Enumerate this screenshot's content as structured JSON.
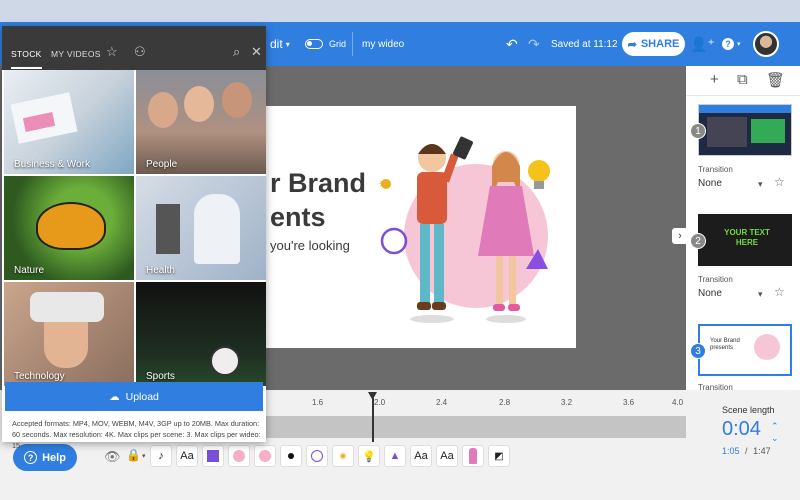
{
  "topbar": {
    "edit_label": "dit",
    "grid_label": "Grid",
    "project_name": "my wideo",
    "saved_label": "Saved at 11:12",
    "share_label": "SHARE"
  },
  "slide": {
    "line1": "r Brand",
    "line2": "ents",
    "line3": "you're looking"
  },
  "stock": {
    "tabs": [
      "STOCK",
      "MY VIDEOS"
    ],
    "categories": [
      "Business & Work",
      "People",
      "Nature",
      "Health",
      "Technology",
      "Sports"
    ],
    "upload_label": "Upload",
    "formats_text": "Accepted formats: MP4, MOV, WEBM, M4V, 3GP up to 20MB. Max duration: 60 seconds. Max resolution: 4K. Max clips per scene: 3. Max clips per wideo: 15"
  },
  "scenes": [
    {
      "num": "1",
      "transition_label": "Transition",
      "transition_value": "None"
    },
    {
      "num": "2",
      "transition_label": "Transition",
      "transition_value": "None",
      "thumb_text": "YOUR TEXT HERE"
    },
    {
      "num": "3",
      "transition_label": "Transition",
      "thumb_text": "Your Brand presents"
    }
  ],
  "timeline": {
    "ticks": [
      "1.6",
      "2.0",
      "2.4",
      "2.8",
      "3.2",
      "3.6",
      "4.0"
    ],
    "layer_labels": [
      "Aa",
      "Aa",
      "Aa",
      "Aa"
    ]
  },
  "scene_length": {
    "label": "Scene length",
    "value": "0:04",
    "current": "1:05",
    "separator": "/",
    "total": "1:47"
  },
  "help_label": "Help",
  "colors": {
    "accent": "#2f7ee0",
    "panel_dark": "#3a3a3a",
    "workspace": "#6b6b6b"
  }
}
